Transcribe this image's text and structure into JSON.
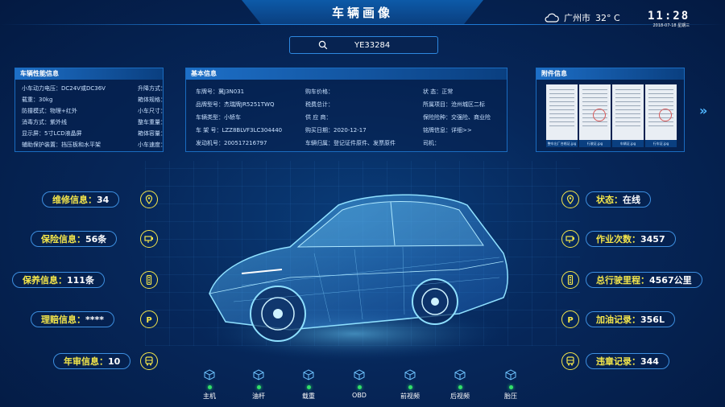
{
  "header": {
    "title": "车辆画像"
  },
  "weather": {
    "city": "广州市",
    "temp": "32° C"
  },
  "clock": {
    "time": "11:28",
    "date": "2018-07-18  星期三"
  },
  "search": {
    "value": "YE33284"
  },
  "panel_perf": {
    "title": "车辆性能信息",
    "left": [
      "小车动力电压：DC24V或DC36V",
      "载重：30kg",
      "防撞模式：物理+红外",
      "消毒方式：紫外线",
      "显示屏：5寸LCD液晶屏",
      "辅助保护装置：挡压板和水平架"
    ],
    "right": [
      "升降方式：",
      "箱体规格：",
      "小车尺寸：",
      "整车重量：",
      "箱体容量：",
      "小车速度："
    ]
  },
  "panel_basic": {
    "title": "基本信息",
    "col1": [
      "车牌号：冀J3N031",
      "品牌型号：杰瑞牌JR5251TWQ",
      "车辆类型：小轿车",
      "车 架 号：LZZ8BLVF3LC304440",
      "发动机号：200517216797"
    ],
    "col2": [
      "购车价格：",
      "税费总计：",
      "供 应 商：",
      "购买日期：2020-12-17",
      "车辆归属：登记证件原件、发票原件"
    ],
    "col3": [
      "状    态：正常",
      "所属项目：沧州城区二标",
      "保险险种：交强险、商业险",
      "铭牌信息：详细>>",
      "司机："
    ]
  },
  "panel_attach": {
    "title": "附件信息",
    "files": [
      "整车出厂合格证.jpg",
      "行驶证.jpg",
      "车辆证.jpg",
      "行车证.jpg"
    ]
  },
  "left_tags": [
    {
      "label": "维修信息：",
      "value": "34",
      "icon": "location-pin-icon"
    },
    {
      "label": "保险信息：",
      "value": "56条",
      "icon": "camera-icon"
    },
    {
      "label": "保养信息：",
      "value": "111条",
      "icon": "traffic-light-icon"
    },
    {
      "label": "理赔信息：",
      "value": "****",
      "icon": "parking-icon"
    },
    {
      "label": "年审信息：",
      "value": "10",
      "icon": "bus-icon"
    }
  ],
  "right_tags": [
    {
      "label": "状态：",
      "value": "在线",
      "icon": "location-pin-icon"
    },
    {
      "label": "作业次数：",
      "value": "3457",
      "icon": "camera-icon"
    },
    {
      "label": "总行驶里程：",
      "value": "4567公里",
      "icon": "traffic-light-icon"
    },
    {
      "label": "加油记录：",
      "value": "356L",
      "icon": "parking-icon"
    },
    {
      "label": "违章记录：",
      "value": "344",
      "icon": "bus-icon"
    }
  ],
  "bottom": [
    "主机",
    "油杆",
    "载重",
    "OBD",
    "前视频",
    "后视频",
    "胎压"
  ],
  "colors": {
    "accent": "#f4e64a",
    "border": "#3d8fe0",
    "status_ok": "#32e06a"
  }
}
